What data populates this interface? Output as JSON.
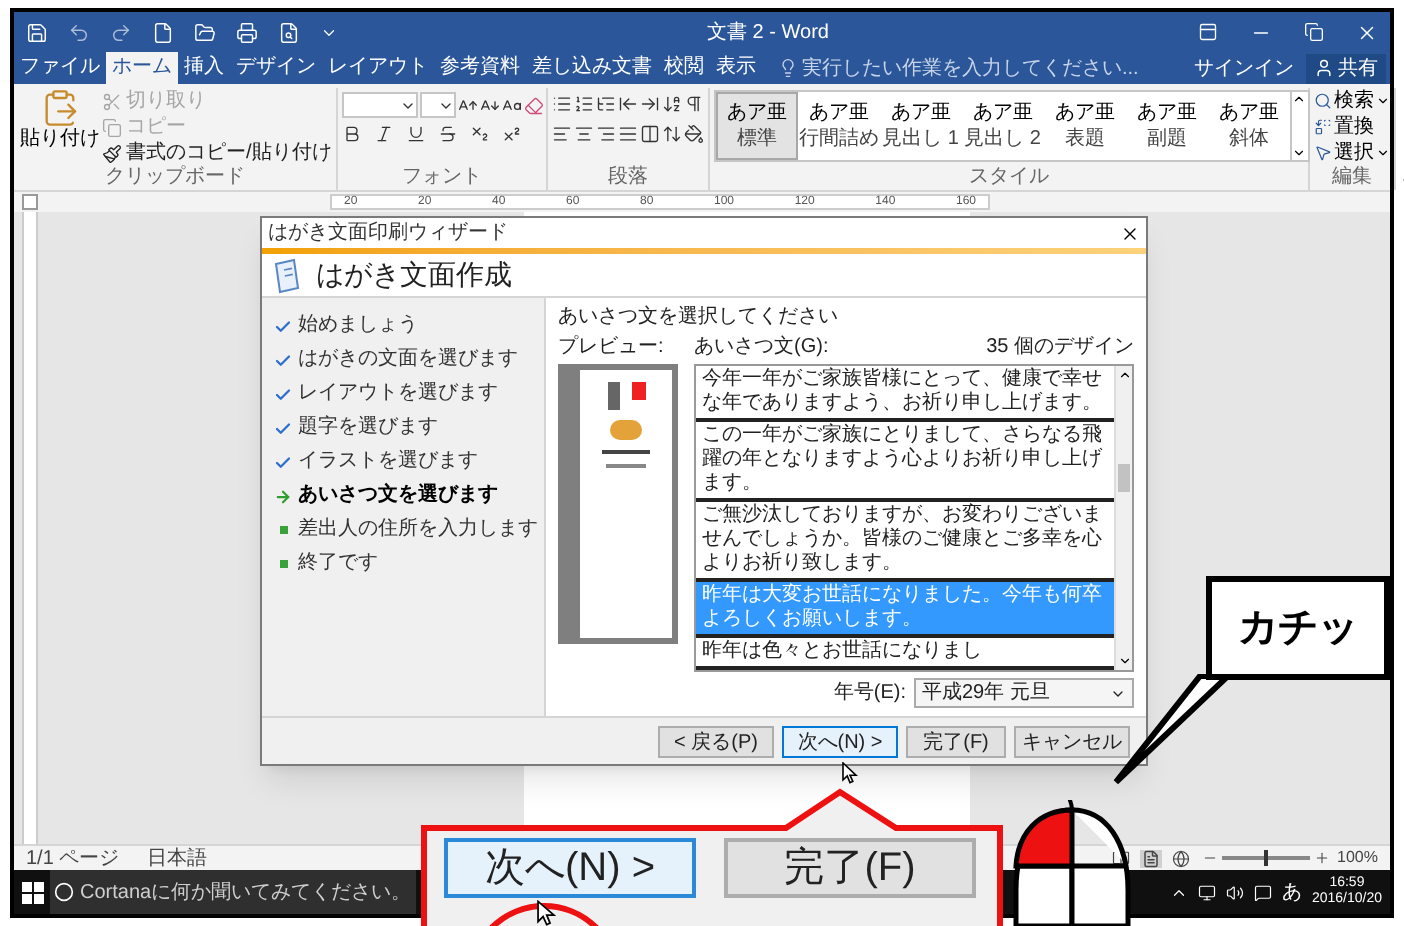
{
  "window": {
    "title": "文書 2 - Word"
  },
  "menu_tabs": [
    {
      "label": "ファイル",
      "selected": false
    },
    {
      "label": "ホーム",
      "selected": true
    },
    {
      "label": "挿入",
      "selected": false
    },
    {
      "label": "デザイン",
      "selected": false
    },
    {
      "label": "レイアウト",
      "selected": false
    },
    {
      "label": "参考資料",
      "selected": false
    },
    {
      "label": "差し込み文書",
      "selected": false
    },
    {
      "label": "校閲",
      "selected": false
    },
    {
      "label": "表示",
      "selected": false
    }
  ],
  "tell_me": {
    "placeholder": "実行したい作業を入力してください..."
  },
  "account": {
    "sign_in": "サインイン",
    "share": "共有"
  },
  "ribbon": {
    "clipboard": {
      "paste": "貼り付け",
      "items": [
        {
          "label": "切り取り",
          "disabled": true
        },
        {
          "label": "コピー",
          "disabled": true
        },
        {
          "label": "書式のコピー/貼り付け",
          "disabled": false
        }
      ],
      "group_label": "クリップボード"
    },
    "font": {
      "group_label": "フォント"
    },
    "paragraph": {
      "group_label": "段落"
    },
    "styles": {
      "items": [
        {
          "preview": "あア亜",
          "name": "標準",
          "selected": true
        },
        {
          "preview": "あア亜",
          "name": "行間詰め",
          "selected": false
        },
        {
          "preview": "あア亜",
          "name": "見出し 1",
          "selected": false
        },
        {
          "preview": "あア亜",
          "name": "見出し 2",
          "selected": false
        },
        {
          "preview": "あア亜",
          "name": "表題",
          "selected": false
        },
        {
          "preview": "あア亜",
          "name": "副題",
          "selected": false
        },
        {
          "preview": "あア亜",
          "name": "斜体",
          "selected": false
        }
      ],
      "group_label": "スタイル"
    },
    "editing": {
      "items": [
        {
          "label": "検索",
          "dropdown": true
        },
        {
          "label": "置換",
          "dropdown": false
        },
        {
          "label": "選択",
          "dropdown": true
        }
      ],
      "group_label": "編集"
    }
  },
  "ruler": {
    "labels": [
      "20",
      "20",
      "40",
      "60",
      "80",
      "100",
      "120",
      "140",
      "160"
    ]
  },
  "dialog": {
    "title": "はがき文面印刷ウィザード",
    "header": "はがき文面作成",
    "steps": [
      {
        "label": "始めましょう",
        "done": true,
        "current": false
      },
      {
        "label": "はがきの文面を選びます",
        "done": true,
        "current": false
      },
      {
        "label": "レイアウトを選びます",
        "done": true,
        "current": false
      },
      {
        "label": "題字を選びます",
        "done": true,
        "current": false
      },
      {
        "label": "イラストを選びます",
        "done": true,
        "current": false
      },
      {
        "label": "あいさつ文を選びます",
        "done": false,
        "current": true
      },
      {
        "label": "差出人の住所を入力します",
        "done": false,
        "current": false
      },
      {
        "label": "終了です",
        "done": false,
        "current": false
      }
    ],
    "prompt": "あいさつ文を選択してください",
    "preview_label": "プレビュー:",
    "list_label": "あいさつ文(G):",
    "design_count": "35 個のデザイン",
    "greetings": [
      {
        "text": "今年一年がご家族皆様にとって、健康で幸せな年でありますよう、お祈り申し上げます。",
        "selected": false
      },
      {
        "text": "この一年がご家族にとりまして、さらなる飛躍の年となりますよう心よりお祈り申し上げます。",
        "selected": false
      },
      {
        "text": "ご無沙汰しておりますが、お変わりございませんでしょうか。皆様のご健康とご多幸を心よりお祈り致します。",
        "selected": false
      },
      {
        "text": "昨年は大変お世話になりました。今年も何卒よろしくお願いします。",
        "selected": true
      },
      {
        "text": "昨年は色々とお世話になりまし",
        "selected": false
      }
    ],
    "era_label": "年号(E):",
    "era_value": "平成29年 元旦",
    "buttons": [
      {
        "label": "< 戻る(P)",
        "focused": false
      },
      {
        "label": "次へ(N) >",
        "focused": true
      },
      {
        "label": "完了(F)",
        "focused": false
      },
      {
        "label": "キャンセル",
        "focused": false
      }
    ]
  },
  "status_bar": {
    "page": "1/1 ページ",
    "language": "日本語",
    "zoom": "100%",
    "zoom_slider": {
      "level": 0.5
    }
  },
  "taskbar": {
    "search_placeholder": "Cortanaに何か聞いてみてください。",
    "ime": "あ",
    "time": "16:59",
    "date": "2016/10/20"
  },
  "zoomed_buttons": [
    {
      "label": "次へ(N) >",
      "focused": true
    },
    {
      "label": "完了(F)",
      "focused": false
    }
  ],
  "speech_bubble": "カチッ"
}
